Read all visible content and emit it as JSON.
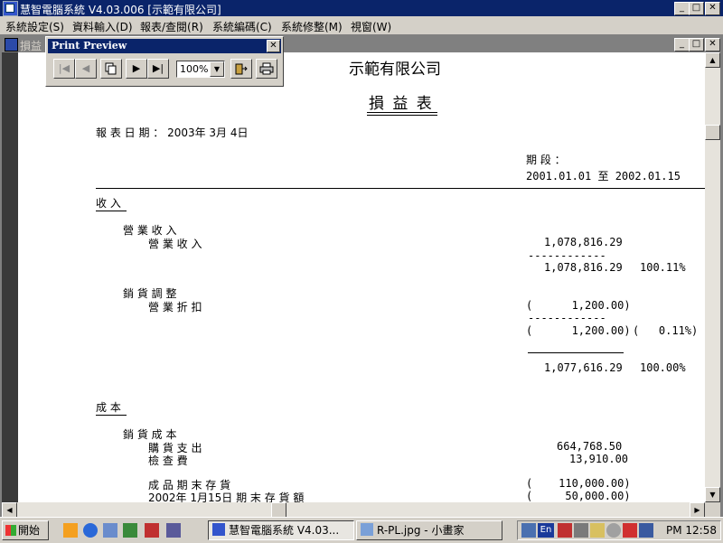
{
  "window": {
    "title": "慧智電腦系統 V4.03.006 [示範有限公司]"
  },
  "menu": [
    {
      "label": "系統設定(S)"
    },
    {
      "label": "資料輸入(D)"
    },
    {
      "label": "報表/查閱(R)"
    },
    {
      "label": "系統編碼(C)"
    },
    {
      "label": "系統修整(M)"
    },
    {
      "label": "視窗(W)"
    }
  ],
  "child": {
    "title": "損益"
  },
  "preview": {
    "title": "Print Preview",
    "zoom": "100%"
  },
  "report": {
    "company": "示範有限公司",
    "title": "損 益 表",
    "date_label": "報 表 日 期 ： 2003年 3月 4日",
    "period_label": "期 段 ：",
    "period_range": "2001.01.01 至 2002.01.15",
    "sec_income": "收 入",
    "grp_op_income": "營 業 收 入",
    "item_op_income": "營 業 收 入",
    "item_op_income_amt": "1,078,816.29",
    "dash1": "------------",
    "sub_op_income": "1,078,816.29",
    "sub_op_income_pct": "100.11%",
    "grp_sales_adj": "銷 貨 調 整",
    "item_discount": "營 業 折 扣",
    "item_discount_amt": "(      1,200.00)",
    "dash2": "------------",
    "sub_discount": "(      1,200.00)",
    "sub_discount_pct": "(   0.11%)",
    "total_income": "1,077,616.29",
    "total_income_pct": "100.00%",
    "sec_cost": "成 本",
    "grp_cogs": "銷 貨 成 本",
    "item_purchase": "購 貨 支 出",
    "item_purchase_amt": "664,768.50",
    "item_inspection": "檢 查 費",
    "item_inspection_amt": "13,910.00",
    "item_end_stock": "成 品 期 末 存 貨",
    "item_end_stock_amt": "(    110,000.00)",
    "item_end_stock2": "2002年 1月15日 期 末 存 貨 額",
    "item_end_stock2_amt": "(     50,000.00)"
  },
  "taskbar": {
    "start": "開始",
    "tasks": [
      {
        "label": "慧智電腦系統 V4.03..."
      },
      {
        "label": "R-PL.jpg - 小畫家"
      }
    ],
    "clock": "PM 12:58",
    "lang": "En"
  }
}
